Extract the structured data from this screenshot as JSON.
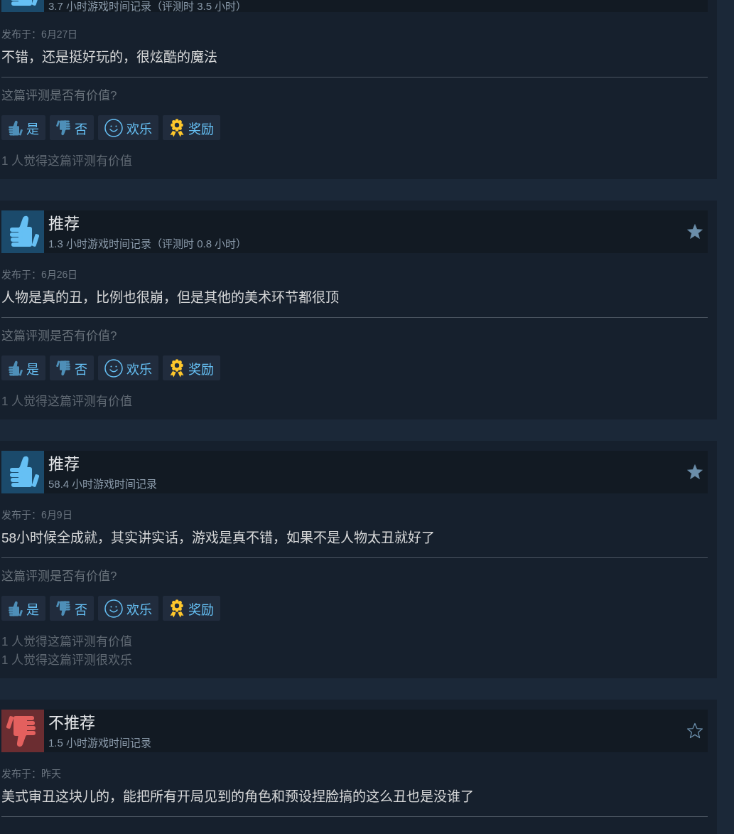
{
  "reviews": [
    {
      "recommended": true,
      "playtime": "3.7 小时游戏时间记录（评测时 3.5 小时）",
      "posted": "发布于：6月27日",
      "text": "不错，还是挺好玩的，很炫酷的魔法",
      "question": "这篇评测是否有价值?",
      "buttons": [
        {
          "kind": "yes",
          "label": "是"
        },
        {
          "kind": "no",
          "label": "否"
        },
        {
          "kind": "funny",
          "label": "欢乐"
        },
        {
          "kind": "award",
          "label": "奖励"
        }
      ],
      "tallies": [
        "1 人觉得这篇评测有价值"
      ]
    },
    {
      "recommended": true,
      "title": "推荐",
      "starred": true,
      "playtime": "1.3 小时游戏时间记录（评测时 0.8 小时）",
      "posted": "发布于：6月26日",
      "text": "人物是真的丑，比例也很崩，但是其他的美术环节都很顶",
      "question": "这篇评测是否有价值?",
      "buttons": [
        {
          "kind": "yes",
          "label": "是"
        },
        {
          "kind": "no",
          "label": "否"
        },
        {
          "kind": "funny",
          "label": "欢乐"
        },
        {
          "kind": "award",
          "label": "奖励"
        }
      ],
      "tallies": [
        "1 人觉得这篇评测有价值"
      ]
    },
    {
      "recommended": true,
      "title": "推荐",
      "starred": true,
      "playtime": "58.4 小时游戏时间记录",
      "posted": "发布于：6月9日",
      "text": "58小时候全成就，其实讲实话，游戏是真不错，如果不是人物太丑就好了",
      "question": "这篇评测是否有价值?",
      "buttons": [
        {
          "kind": "yes",
          "label": "是"
        },
        {
          "kind": "no",
          "label": "否"
        },
        {
          "kind": "funny",
          "label": "欢乐"
        },
        {
          "kind": "award",
          "label": "奖励"
        }
      ],
      "tallies": [
        "1 人觉得这篇评测有价值",
        "1 人觉得这篇评测很欢乐"
      ]
    },
    {
      "recommended": false,
      "title": "不推荐",
      "starred": false,
      "playtime": "1.5 小时游戏时间记录",
      "posted": "发布于：昨天",
      "text": "美式审丑这块儿的，能把所有开局见到的角色和预设捏脸搞的这么丑也是没谁了"
    }
  ]
}
